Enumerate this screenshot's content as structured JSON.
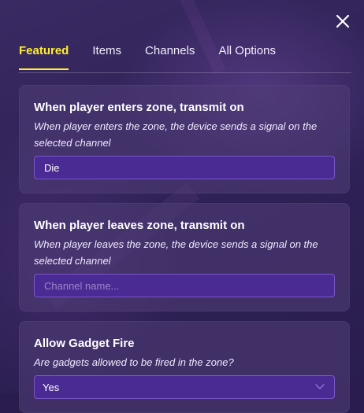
{
  "close_label": "×",
  "tabs": [
    {
      "label": "Featured",
      "active": true
    },
    {
      "label": "Items",
      "active": false
    },
    {
      "label": "Channels",
      "active": false
    },
    {
      "label": "All Options",
      "active": false
    }
  ],
  "settings": [
    {
      "title": "When player enters zone, transmit on",
      "description": "When player enters the zone, the device sends a signal on the selected channel",
      "value": "Die",
      "placeholder": ""
    },
    {
      "title": "When player leaves zone, transmit on",
      "description": "When player leaves the zone, the device sends a signal on the selected channel",
      "value": "",
      "placeholder": "Channel name..."
    },
    {
      "title": "Allow Gadget Fire",
      "description": "Are gadgets allowed to be fired in the zone?",
      "value": "Yes"
    }
  ],
  "icons": {
    "close": "close-icon",
    "dropdown": "chevron-down-icon"
  },
  "colors": {
    "accent": "#ffee2e",
    "field_bg": "#4a2a93",
    "field_border": "#7857c9",
    "card_bg": "#4e3c74"
  }
}
